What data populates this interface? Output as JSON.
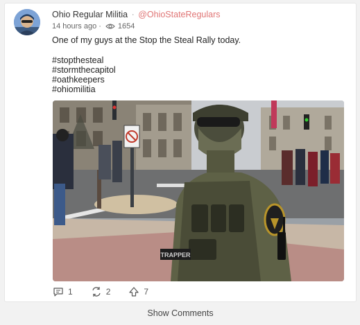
{
  "post": {
    "author_name": "Ohio Regular Militia",
    "separator": "·",
    "handle": "@OhioStateRegulars",
    "time_ago": "14 hours ago",
    "separator2": "·",
    "views": "1654",
    "text": "One of my guys at the Stop the Steal Rally today.",
    "hashtags": [
      "#stopthesteal",
      "#stormthecapitol",
      "#oathkeepers",
      "#ohiomilitia"
    ],
    "photo_label": "TRAPPER"
  },
  "actions": {
    "comments_count": "1",
    "reposts_count": "2",
    "upvotes_count": "7"
  },
  "footer": {
    "show_comments_label": "Show Comments"
  },
  "icons": {
    "views": "eye-icon",
    "comments": "comment-icon",
    "reposts": "repost-icon",
    "upvotes": "upvote-icon"
  },
  "colors": {
    "handle": "#e07575",
    "avatar_bg": "#5b86c7"
  }
}
